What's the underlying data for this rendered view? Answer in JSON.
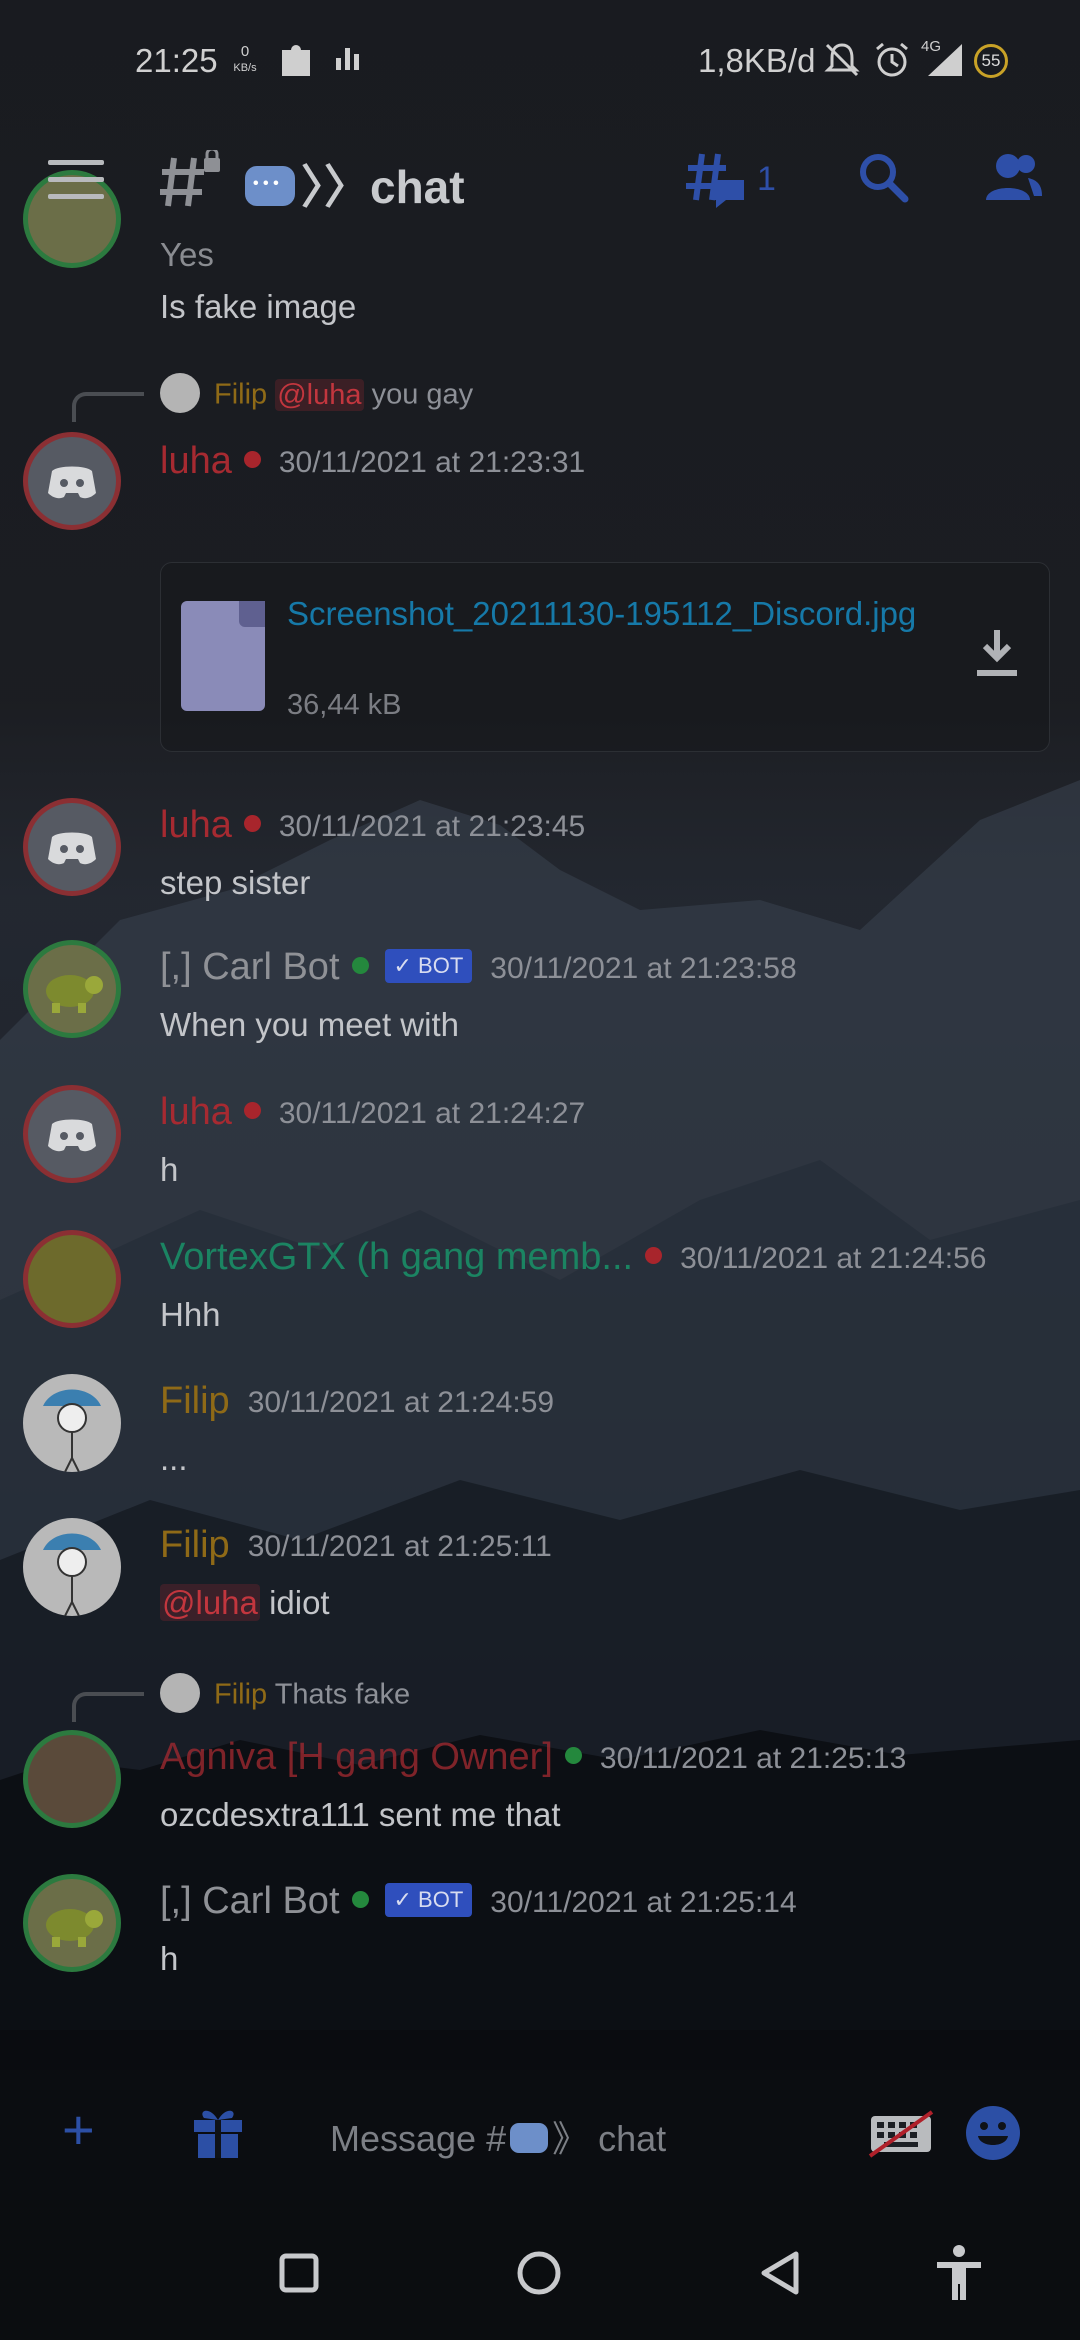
{
  "status_bar": {
    "time": "21:25",
    "speed_value": "0",
    "speed_unit": "KB/s",
    "data_usage": "1,8KB/d",
    "network_type": "4G",
    "battery": "55",
    "icons": [
      "puzzle-icon",
      "bars-icon",
      "mute-bell-icon",
      "alarm-icon",
      "signal-icon"
    ]
  },
  "header": {
    "channel_name": "chat",
    "thread_count": "1",
    "icons": [
      "menu-icon",
      "locked-hash-icon",
      "threads-icon",
      "search-icon",
      "members-icon"
    ],
    "accent": "#2e4fa8"
  },
  "messages": [
    {
      "text_partial": "Yes",
      "text": "Is fake image"
    },
    {
      "reply_user": "Filip",
      "reply_mention": "@luha",
      "reply_text": "you gay",
      "user": "luha",
      "timestamp": "30/11/2021 at 21:23:31",
      "attachment": {
        "filename": "Screenshot_20211130-195112_Discord.jpg",
        "size": "36,44 kB"
      }
    },
    {
      "user": "luha",
      "timestamp": "30/11/2021 at 21:23:45",
      "text": "step sister"
    },
    {
      "user": "[,] Carl Bot",
      "bot_tag": "BOT",
      "timestamp": "30/11/2021 at 21:23:58",
      "text": "When you meet with"
    },
    {
      "user": "luha",
      "timestamp": "30/11/2021 at 21:24:27",
      "text": "h"
    },
    {
      "user": "VortexGTX (h gang memb...",
      "timestamp": "30/11/2021 at 21:24:56",
      "text": "Hhh"
    },
    {
      "user": "Filip",
      "timestamp": "30/11/2021 at 21:24:59",
      "text": "..."
    },
    {
      "user": "Filip",
      "timestamp": "30/11/2021 at 21:25:11",
      "mention": "@luha",
      "text": "idiot"
    },
    {
      "reply_user": "Filip",
      "reply_text": "Thats fake",
      "user": "Agniva [H gang Owner]",
      "timestamp": "30/11/2021 at 21:25:13",
      "text": "ozcdesxtra111 sent me that"
    },
    {
      "user": "[,] Carl Bot",
      "bot_tag": "BOT",
      "timestamp": "30/11/2021 at 21:25:14",
      "text": "h"
    }
  ],
  "composer": {
    "placeholder_prefix": "Message #",
    "placeholder_channel": "》 chat",
    "icons": [
      "plus-icon",
      "gift-icon",
      "keyboard-icon",
      "emoji-icon"
    ]
  },
  "navbar": {
    "icons": [
      "recents-icon",
      "home-icon",
      "back-icon",
      "accessibility-icon"
    ]
  },
  "colors": {
    "offline_red": "#a8252c",
    "online_green": "#24883d",
    "link_blue": "#1679a8",
    "name_orange": "#8f6a17",
    "name_teal": "#1b8462"
  }
}
